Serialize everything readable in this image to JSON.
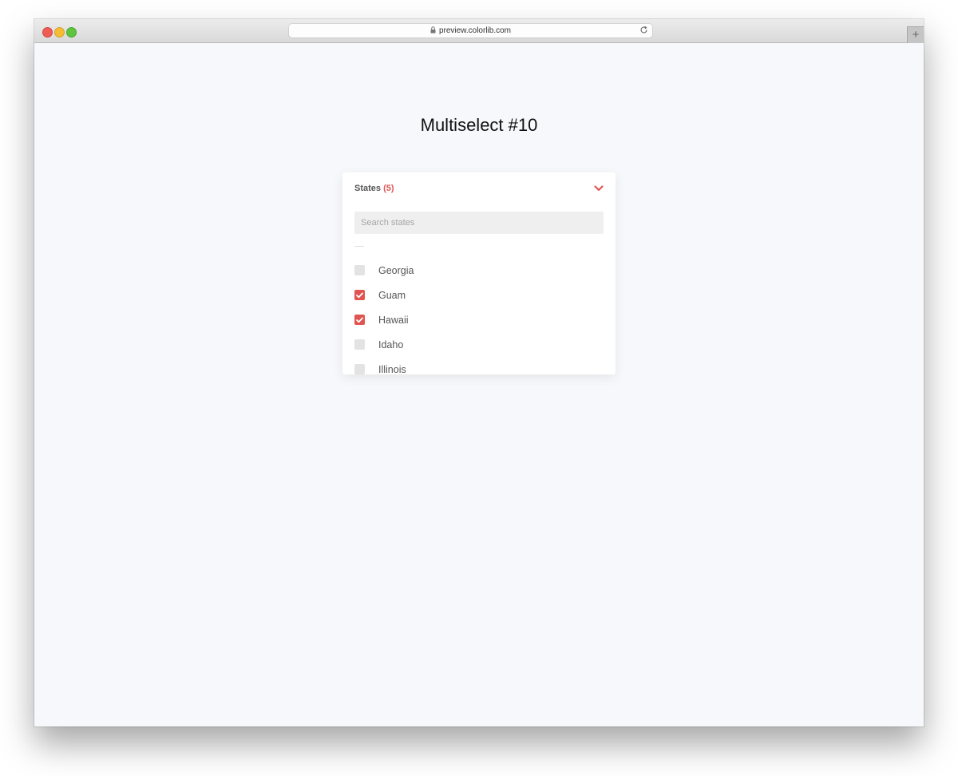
{
  "browser": {
    "url": "preview.colorlib.com",
    "new_tab_symbol": "+"
  },
  "page": {
    "title": "Multiselect #10"
  },
  "multiselect": {
    "label": "States",
    "selected_count": "(5)",
    "search_placeholder": "Search states",
    "accent_color": "#e05552",
    "options": [
      {
        "label": "Georgia",
        "checked": false
      },
      {
        "label": "Guam",
        "checked": true
      },
      {
        "label": "Hawaii",
        "checked": true
      },
      {
        "label": "Idaho",
        "checked": false
      },
      {
        "label": "Illinois",
        "checked": false
      }
    ]
  }
}
